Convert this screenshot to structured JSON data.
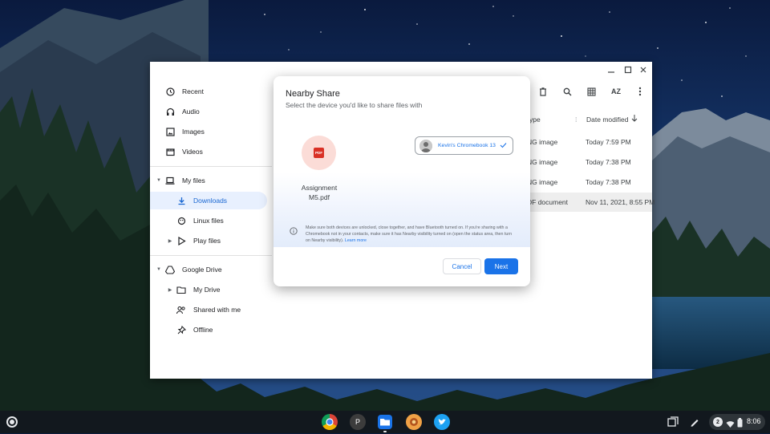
{
  "sidebar": {
    "recent": "Recent",
    "audio": "Audio",
    "images": "Images",
    "videos": "Videos",
    "my_files": "My files",
    "downloads": "Downloads",
    "linux_files": "Linux files",
    "play_files": "Play files",
    "google_drive": "Google Drive",
    "my_drive": "My Drive",
    "shared_with_me": "Shared with me",
    "offline": "Offline"
  },
  "toolbar": {
    "sort_label": "AZ"
  },
  "file_list": {
    "col_type": "ype",
    "col_date": "Date modified",
    "rows": [
      {
        "type": "NG image",
        "date": "Today 7:59 PM"
      },
      {
        "type": "NG image",
        "date": "Today 7:38 PM"
      },
      {
        "type": "NG image",
        "date": "Today 7:38 PM"
      },
      {
        "type": "DF document",
        "date": "Nov 11, 2021, 8:55 PM"
      }
    ]
  },
  "dialog": {
    "title": "Nearby Share",
    "subtitle": "Select the device you'd like to share files with",
    "file_icon_text": "PDF",
    "file_name_line1": "Assignment",
    "file_name_line2": "M5.pdf",
    "device_name": "Kevin's Chromebook 13",
    "info_text": "Make sure both devices are unlocked, close together, and have Bluetooth turned on. If you're sharing with a Chromebook not in your contacts, make sure it has Nearby visibility turned on (open the status area, then turn on Nearby visibility).",
    "learn_more": "Learn more",
    "cancel_label": "Cancel",
    "next_label": "Next"
  },
  "shelf": {
    "profile_initial": "P",
    "notification_count": "2",
    "time": "8:06"
  },
  "colors": {
    "accent": "#1a73e8",
    "pdf_red": "#d93025"
  }
}
